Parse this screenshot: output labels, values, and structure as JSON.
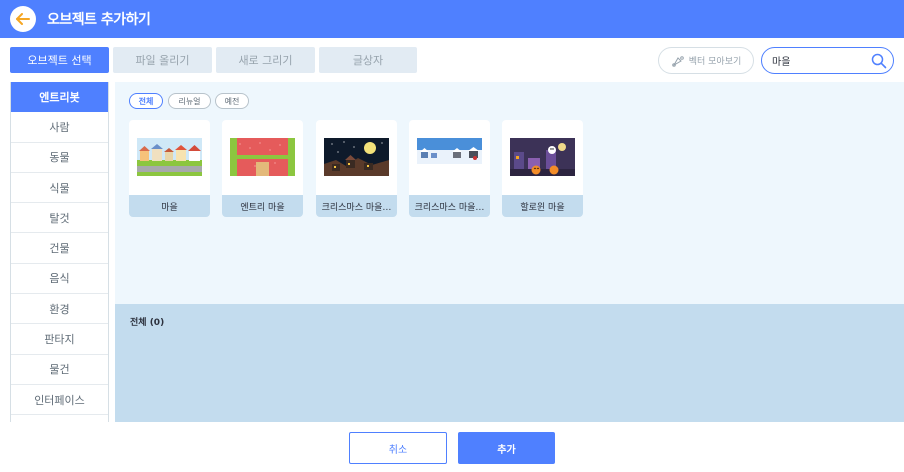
{
  "header": {
    "title": "오브젝트 추가하기",
    "back_icon": "back-arrow-icon",
    "color": "#4f80ff"
  },
  "tabs": [
    {
      "label": "오브젝트 선택",
      "active": true
    },
    {
      "label": "파일 올리기",
      "active": false
    },
    {
      "label": "새로 그리기",
      "active": false
    },
    {
      "label": "글상자",
      "active": false
    }
  ],
  "vector_button": {
    "label": "벡터 모아보기",
    "icon": "vector-pen-icon"
  },
  "search": {
    "value": "마을",
    "placeholder": "",
    "icon": "search-icon"
  },
  "sidebar": {
    "items": [
      {
        "label": "엔트리봇",
        "active": true
      },
      {
        "label": "사람"
      },
      {
        "label": "동물"
      },
      {
        "label": "식물"
      },
      {
        "label": "탈것"
      },
      {
        "label": "건물"
      },
      {
        "label": "음식"
      },
      {
        "label": "환경"
      },
      {
        "label": "판타지"
      },
      {
        "label": "물건"
      },
      {
        "label": "인터페이스"
      }
    ]
  },
  "filters": [
    {
      "label": "전체",
      "active": true
    },
    {
      "label": "리뉴얼",
      "active": false
    },
    {
      "label": "예전",
      "active": false
    }
  ],
  "objects": [
    {
      "label": "마을",
      "thumb": "village"
    },
    {
      "label": "엔트리 마을",
      "thumb": "entry-village"
    },
    {
      "label": "크리스마스 마을…",
      "thumb": "christmas-night"
    },
    {
      "label": "크리스마스 마을…",
      "thumb": "christmas-snow"
    },
    {
      "label": "할로윈 마을",
      "thumb": "halloween"
    }
  ],
  "selected": {
    "title": "전체 (0)"
  },
  "buttons": {
    "cancel": "취소",
    "add": "추가"
  }
}
